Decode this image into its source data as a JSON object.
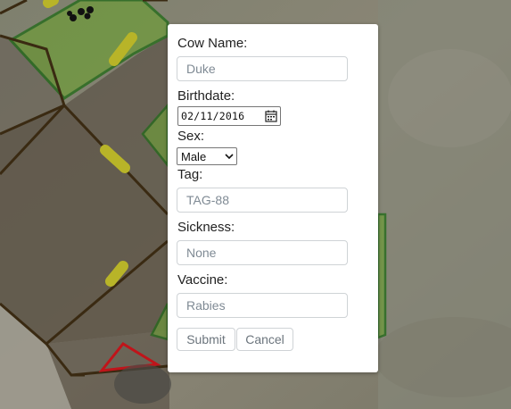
{
  "form": {
    "cow_name_label": "Cow Name:",
    "cow_name_placeholder": "Duke",
    "birthdate_label": "Birthdate:",
    "birthdate_value": "02/11/2016",
    "sex_label": "Sex:",
    "sex_value": "Male",
    "tag_label": "Tag:",
    "tag_placeholder": "TAG-88",
    "sickness_label": "Sickness:",
    "sickness_placeholder": "None",
    "vaccine_label": "Vaccine:",
    "vaccine_placeholder": "Rabies",
    "submit_label": "Submit",
    "cancel_label": "Cancel"
  },
  "icons": {
    "date_picker": "calendar-icon",
    "select_arrow": "chevron-down-icon"
  },
  "colors": {
    "paddock_fill": "#6f9a3c",
    "paddock_border": "#1f6a16",
    "boundary_line": "#3a2a12",
    "gate_marker": "#b8b428",
    "alert_polygon": "#c0141a"
  }
}
